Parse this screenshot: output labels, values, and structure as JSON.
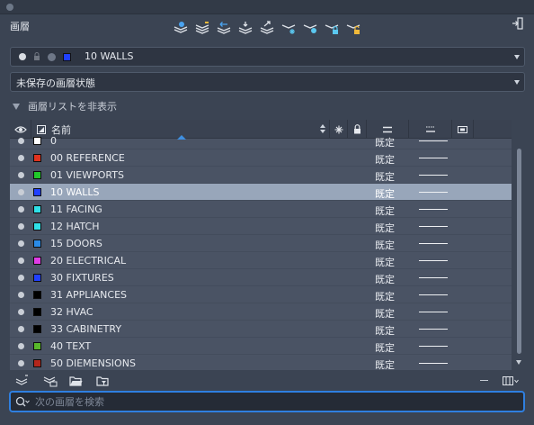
{
  "panel": {
    "title": "画層"
  },
  "current_layer": {
    "name": "10 WALLS",
    "color": "#2040ff"
  },
  "layer_state": {
    "value": "未保存の画層状態"
  },
  "list_toggle": {
    "label": "画層リストを非表示"
  },
  "table": {
    "name_header": "名前",
    "rows": [
      {
        "name": "0",
        "color": "#ffffff",
        "linetype": "既定",
        "selected": false
      },
      {
        "name": "00 REFERENCE",
        "color": "#e0321e",
        "linetype": "既定",
        "selected": false
      },
      {
        "name": "01 VIEWPORTS",
        "color": "#21c82a",
        "linetype": "既定",
        "selected": false
      },
      {
        "name": "10 WALLS",
        "color": "#2040ff",
        "linetype": "既定",
        "selected": true
      },
      {
        "name": "11 FACING",
        "color": "#2fe0e8",
        "linetype": "既定",
        "selected": false
      },
      {
        "name": "12 HATCH",
        "color": "#2fe0e8",
        "linetype": "既定",
        "selected": false
      },
      {
        "name": "15 DOORS",
        "color": "#2a8ae6",
        "linetype": "既定",
        "selected": false
      },
      {
        "name": "20 ELECTRICAL",
        "color": "#e03ce6",
        "linetype": "既定",
        "selected": false
      },
      {
        "name": "30 FIXTURES",
        "color": "#2040ff",
        "linetype": "既定",
        "selected": false
      },
      {
        "name": "31 APPLIANCES",
        "color": "#000000",
        "linetype": "既定",
        "selected": false
      },
      {
        "name": "32 HVAC",
        "color": "#000000",
        "linetype": "既定",
        "selected": false
      },
      {
        "name": "33 CABINETRY",
        "color": "#000000",
        "linetype": "既定",
        "selected": false
      },
      {
        "name": "40 TEXT",
        "color": "#58b82a",
        "linetype": "既定",
        "selected": false
      },
      {
        "name": "50 DIEMENSIONS",
        "color": "#b2261c",
        "linetype": "既定",
        "selected": false
      }
    ]
  },
  "search": {
    "placeholder": "次の画層を検索"
  },
  "colors": {
    "panel_bg": "#3b4453",
    "list_bg": "#4a5364",
    "selected_row": "#98a6ba",
    "accent": "#2f7fe0"
  }
}
